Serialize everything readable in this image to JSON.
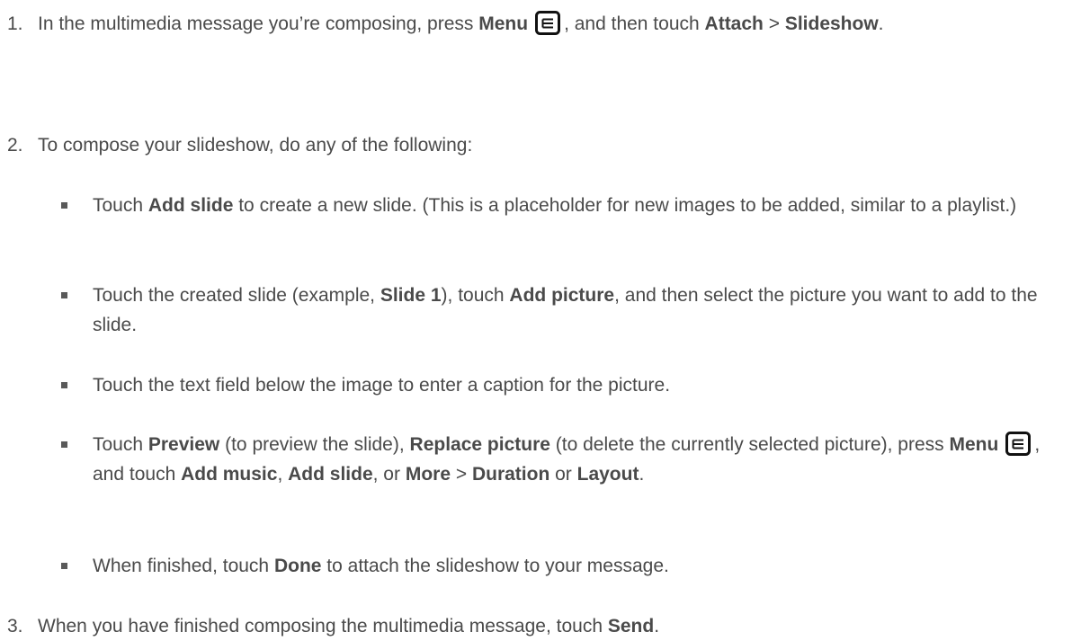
{
  "steps": [
    {
      "num": "1.",
      "parts": [
        {
          "t": "In the multimedia message you’re composing, press "
        },
        {
          "b": "Menu"
        },
        {
          "icon": "menu-icon"
        },
        {
          "t": ", and then touch "
        },
        {
          "b": "Attach"
        },
        {
          "t": " > "
        },
        {
          "b": "Slideshow"
        },
        {
          "t": "."
        }
      ]
    },
    {
      "num": "2.",
      "parts": [
        {
          "t": "To compose your slideshow, do any of the following:"
        }
      ]
    },
    {
      "num": "3.",
      "parts": [
        {
          "t": "When you have finished composing the multimedia message, touch "
        },
        {
          "b": "Send"
        },
        {
          "t": "."
        }
      ]
    }
  ],
  "bullets": [
    {
      "parts": [
        {
          "t": "Touch "
        },
        {
          "b": "Add slide"
        },
        {
          "t": " to create a new slide. (This is a placeholder for new images to be added, similar to a playlist.)"
        }
      ]
    },
    {
      "parts": [
        {
          "t": "Touch the created slide (example, "
        },
        {
          "b": "Slide 1"
        },
        {
          "t": "), touch "
        },
        {
          "b": "Add picture"
        },
        {
          "t": ", and then select the picture you want to add to the slide."
        }
      ]
    },
    {
      "parts": [
        {
          "t": "Touch the text field below the image to enter a caption for the picture."
        }
      ]
    },
    {
      "parts": [
        {
          "t": "Touch "
        },
        {
          "b": "Preview"
        },
        {
          "t": " (to preview the slide), "
        },
        {
          "b": "Replace picture"
        },
        {
          "t": " (to delete the currently selected picture), press "
        },
        {
          "b": "Menu"
        },
        {
          "icon": "menu-icon"
        },
        {
          "t": ", and touch "
        },
        {
          "b": "Add music"
        },
        {
          "t": ", "
        },
        {
          "b": "Add slide"
        },
        {
          "t": ", or "
        },
        {
          "b": "More"
        },
        {
          "t": " > "
        },
        {
          "b": "Duration"
        },
        {
          "t": " or "
        },
        {
          "b": "Layout"
        },
        {
          "t": "."
        }
      ]
    },
    {
      "parts": [
        {
          "t": "When finished, touch "
        },
        {
          "b": "Done"
        },
        {
          "t": " to attach the slideshow to your message."
        }
      ]
    }
  ]
}
